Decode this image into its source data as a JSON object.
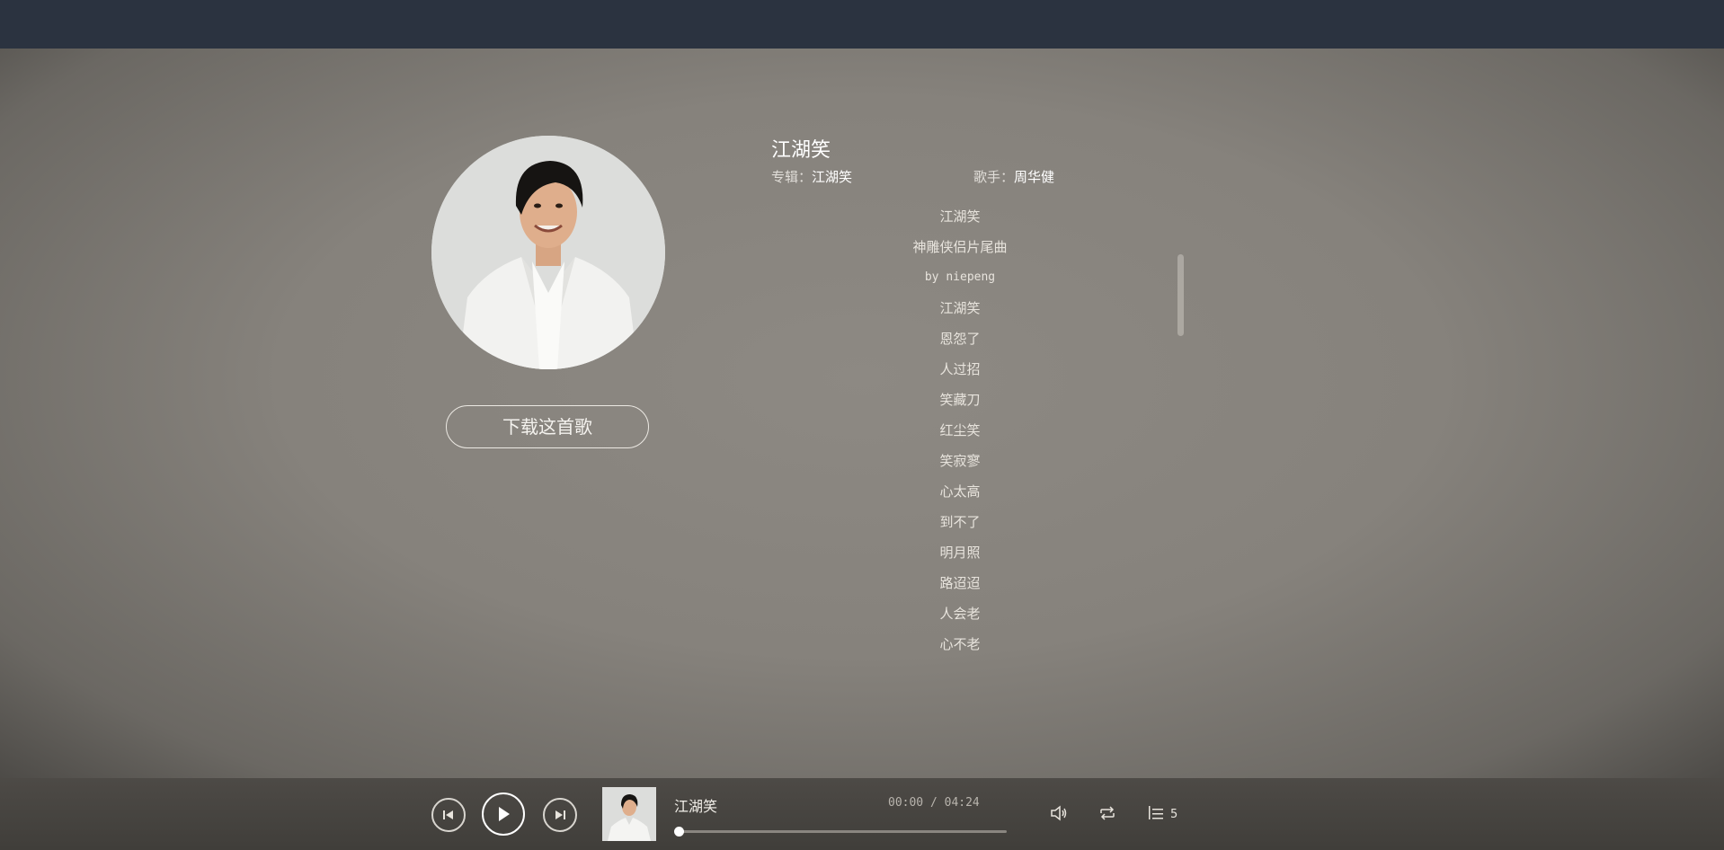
{
  "song": {
    "title": "江湖笑",
    "album_label": "专辑：",
    "album": "江湖笑",
    "singer_label": "歌手：",
    "singer": "周华健"
  },
  "download_label": "下载这首歌",
  "lyrics": [
    "江湖笑",
    "神雕侠侣片尾曲",
    "by niepeng",
    "江湖笑",
    "恩怨了",
    "人过招",
    "笑藏刀",
    "红尘笑",
    "笑寂寥",
    "心太高",
    "到不了",
    "明月照",
    "路迢迢",
    "人会老",
    "心不老"
  ],
  "player": {
    "title": "江湖笑",
    "current_time": "00:00",
    "separator": "/",
    "duration": "04:24",
    "progress": 0,
    "playlist_count": "5"
  },
  "colors": {
    "top_bar": "#2b3340",
    "player_bar": "#4a4743",
    "background": "#8a8680"
  },
  "icons": [
    "prev-icon",
    "play-icon",
    "next-icon",
    "volume-icon",
    "loop-icon",
    "playlist-icon"
  ]
}
